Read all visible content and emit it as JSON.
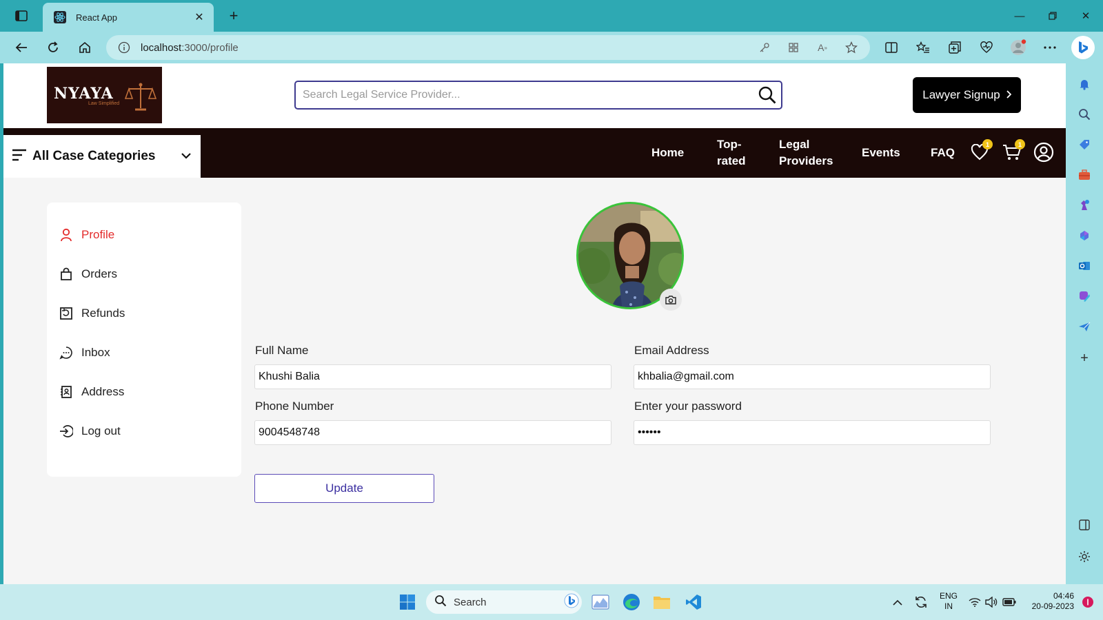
{
  "browser": {
    "tab_title": "React App",
    "url_host": "localhost",
    "url_rest": ":3000/profile"
  },
  "site": {
    "logo_text": "NYAYA",
    "logo_tagline": "Law Simplified",
    "search_placeholder": "Search Legal Service Provider...",
    "signup_label": "Lawyer Signup",
    "category_label": "All Case Categories",
    "nav": {
      "home": "Home",
      "top_rated_1": "Top-",
      "top_rated_2": "rated",
      "legal_1": "Legal",
      "legal_2": "Providers",
      "events": "Events",
      "faq": "FAQ"
    },
    "wishlist_count": "1",
    "cart_count": "1"
  },
  "profile_menu": {
    "profile": "Profile",
    "orders": "Orders",
    "refunds": "Refunds",
    "inbox": "Inbox",
    "address": "Address",
    "logout": "Log out"
  },
  "form": {
    "full_name_label": "Full Name",
    "full_name_value": "Khushi Balia",
    "email_label": "Email Address",
    "email_value": "khbalia@gmail.com",
    "phone_label": "Phone Number",
    "phone_value": "9004548748",
    "password_label": "Enter your password",
    "password_value": "••••••",
    "update_label": "Update"
  },
  "taskbar": {
    "search_label": "Search",
    "lang_1": "ENG",
    "lang_2": "IN",
    "time": "04:46",
    "date": "20-09-2023"
  },
  "colors": {
    "active_menu": "#e32b2b",
    "navbar_bg": "#1a0907",
    "avatar_ring": "#3ac43a",
    "update_btn": "#5b4bb7"
  }
}
